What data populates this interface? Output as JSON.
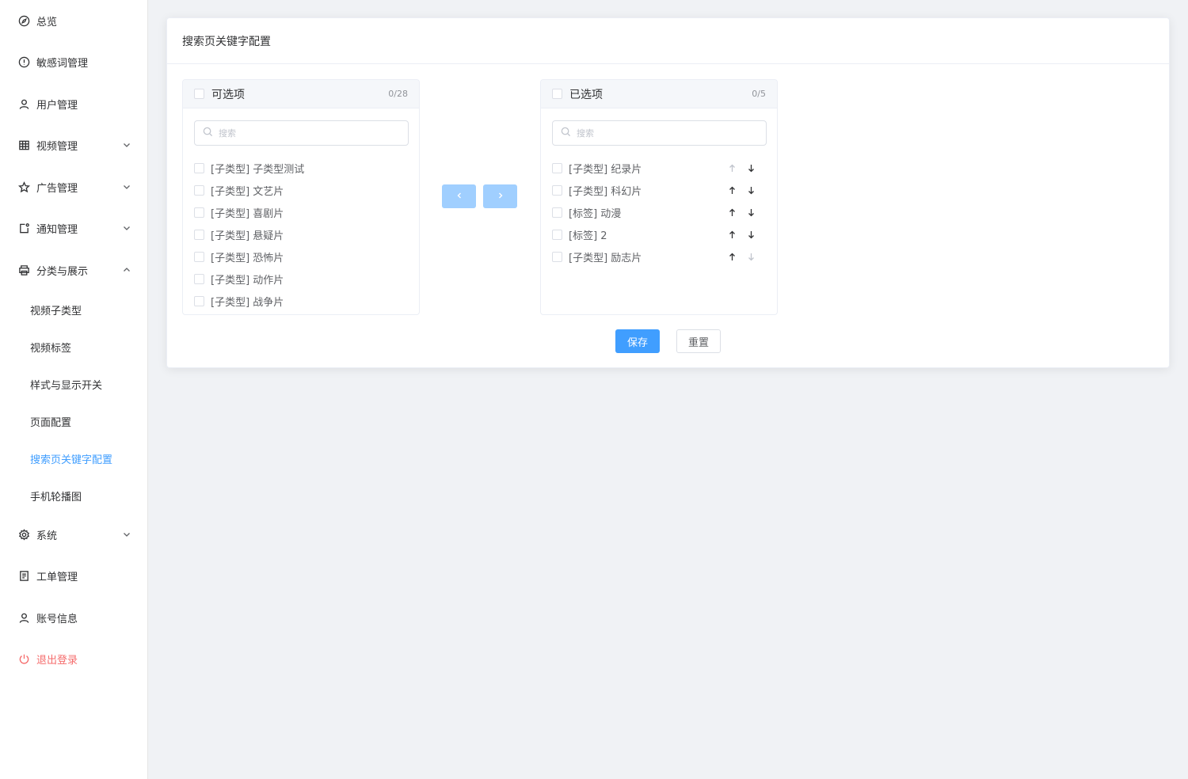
{
  "sidebar": {
    "items": [
      {
        "label": "总览",
        "icon": "compass-icon"
      },
      {
        "label": "敏感词管理",
        "icon": "alert-circle-icon"
      },
      {
        "label": "用户管理",
        "icon": "user-icon"
      },
      {
        "label": "视频管理",
        "icon": "grid-icon"
      },
      {
        "label": "广告管理",
        "icon": "star-icon"
      },
      {
        "label": "通知管理",
        "icon": "notification-icon"
      },
      {
        "label": "分类与展示",
        "icon": "printer-icon"
      },
      {
        "label": "系统",
        "icon": "gear-icon"
      },
      {
        "label": "工单管理",
        "icon": "document-icon"
      },
      {
        "label": "账号信息",
        "icon": "user-icon"
      },
      {
        "label": "退出登录",
        "icon": "power-icon"
      }
    ],
    "submenu": [
      {
        "label": "视频子类型"
      },
      {
        "label": "视频标签"
      },
      {
        "label": "样式与显示开关"
      },
      {
        "label": "页面配置"
      },
      {
        "label": "搜索页关键字配置",
        "active": true
      },
      {
        "label": "手机轮播图"
      }
    ]
  },
  "card": {
    "title": "搜索页关键字配置"
  },
  "transfer": {
    "left": {
      "title": "可选项",
      "count": "0/28",
      "search_placeholder": "搜索",
      "items": [
        "[子类型] 子类型测试",
        "[子类型] 文艺片",
        "[子类型] 喜剧片",
        "[子类型] 悬疑片",
        "[子类型] 恐怖片",
        "[子类型] 动作片",
        "[子类型] 战争片"
      ]
    },
    "right": {
      "title": "已选项",
      "count": "0/5",
      "search_placeholder": "搜索",
      "items": [
        "[子类型] 纪录片",
        "[子类型] 科幻片",
        "[标签] 动漫",
        "[标签] 2",
        "[子类型] 励志片"
      ]
    }
  },
  "actions": {
    "save_label": "保存",
    "reset_label": "重置"
  },
  "colors": {
    "accent": "#409eff",
    "accent_disabled": "#a0cfff",
    "danger": "#f56c6c"
  }
}
